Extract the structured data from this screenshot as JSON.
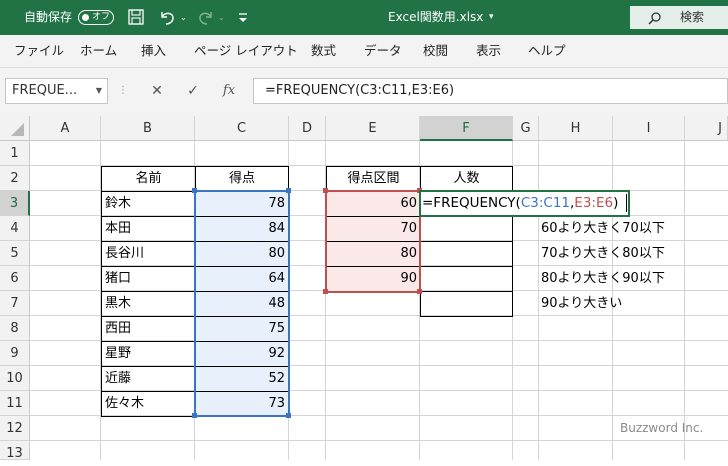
{
  "titlebar": {
    "autosave_label": "自動保存",
    "autosave_state": "オフ",
    "filename": "Excel関数用.xlsx",
    "filename_caret": "▾",
    "search_label": "検索",
    "color": "#217346"
  },
  "ribbon_tabs": [
    "ファイル",
    "ホーム",
    "挿入",
    "ページ レイアウト",
    "数式",
    "データ",
    "校閲",
    "表示",
    "ヘルプ"
  ],
  "formula_bar": {
    "name_box": "FREQUE...",
    "cancel": "✕",
    "enter": "✓",
    "fx": "fx",
    "formula": "=FREQUENCY(C3:C11,E3:E6)"
  },
  "columns": [
    "A",
    "B",
    "C",
    "D",
    "E",
    "F",
    "G",
    "H",
    "I",
    "J"
  ],
  "rows": [
    "1",
    "2",
    "3",
    "4",
    "5",
    "6",
    "7",
    "8",
    "9",
    "10",
    "11",
    "12",
    "13"
  ],
  "table1": {
    "header": [
      "名前",
      "得点"
    ],
    "rows": [
      [
        "鈴木",
        "78"
      ],
      [
        "本田",
        "84"
      ],
      [
        "長谷川",
        "80"
      ],
      [
        "猪口",
        "64"
      ],
      [
        "黒木",
        "48"
      ],
      [
        "西田",
        "75"
      ],
      [
        "星野",
        "92"
      ],
      [
        "近藤",
        "52"
      ],
      [
        "佐々木",
        "73"
      ]
    ]
  },
  "table2": {
    "header": [
      "得点区間",
      "人数"
    ],
    "bins": [
      "60",
      "70",
      "80",
      "90"
    ]
  },
  "editing_cell": {
    "prefix": "=FREQUENCY(",
    "ref1": "C3:C11",
    "comma": ",",
    "ref2": "E3:E6",
    "suffix": ")"
  },
  "notes": [
    "60より大きく70以下",
    "70より大きく80以下",
    "80より大きく90以下",
    "90より大きい"
  ],
  "watermark": "Buzzword Inc.",
  "colors": {
    "ref1": "#3a74c2",
    "ref2": "#c0504d",
    "active": "#217346"
  }
}
